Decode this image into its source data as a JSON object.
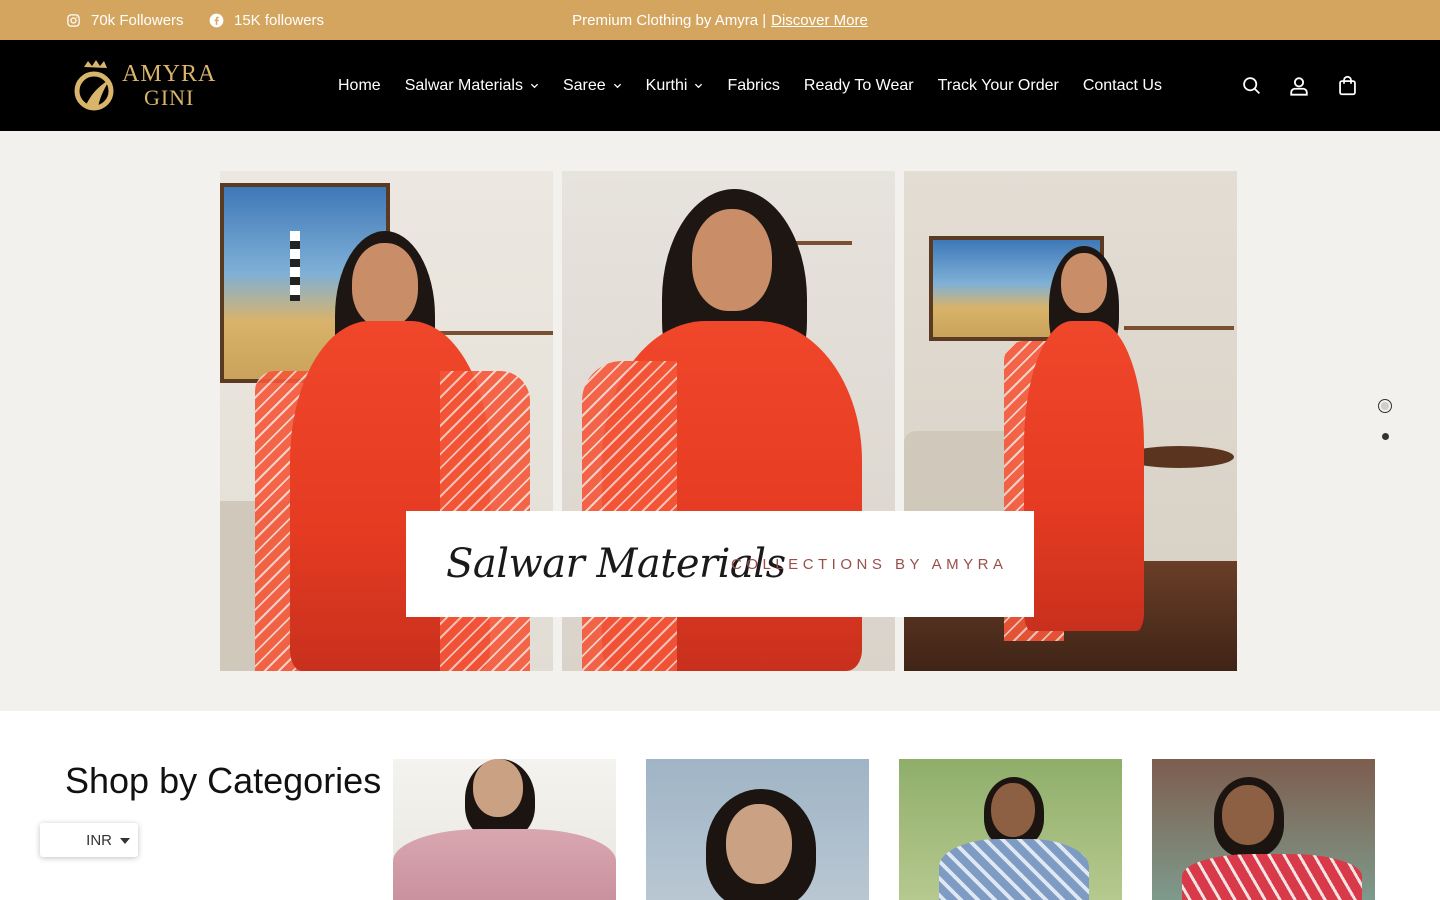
{
  "announcement": {
    "instagram": {
      "icon": "instagram-icon",
      "label": "70k Followers"
    },
    "facebook": {
      "icon": "facebook-icon",
      "label": "15K followers"
    },
    "promo_text": "Premium Clothing by Amyra |",
    "promo_link": "Discover More"
  },
  "header": {
    "logo": {
      "line1": "AMYRA",
      "line2": "GINI"
    },
    "nav": [
      {
        "label": "Home",
        "has_dropdown": false
      },
      {
        "label": "Salwar Materials",
        "has_dropdown": true
      },
      {
        "label": "Saree",
        "has_dropdown": true
      },
      {
        "label": "Kurthi",
        "has_dropdown": true
      },
      {
        "label": "Fabrics",
        "has_dropdown": false
      },
      {
        "label": "Ready To Wear",
        "has_dropdown": false
      },
      {
        "label": "Track Your Order",
        "has_dropdown": false
      },
      {
        "label": "Contact Us",
        "has_dropdown": false
      }
    ],
    "icons": [
      "search-icon",
      "account-icon",
      "cart-icon"
    ]
  },
  "hero": {
    "caption_title": "Salwar Materials",
    "caption_subtitle": "COLLECTIONS BY AMYRA",
    "slides_total": 2,
    "active_slide": 1
  },
  "categories": {
    "title": "Shop by Categories"
  },
  "currency": {
    "selected": "INR"
  },
  "colors": {
    "announcement_bg": "#d4a55f",
    "header_bg": "#000000",
    "logo_gold": "#d8b56a",
    "hero_bg": "#f3f1ee"
  }
}
